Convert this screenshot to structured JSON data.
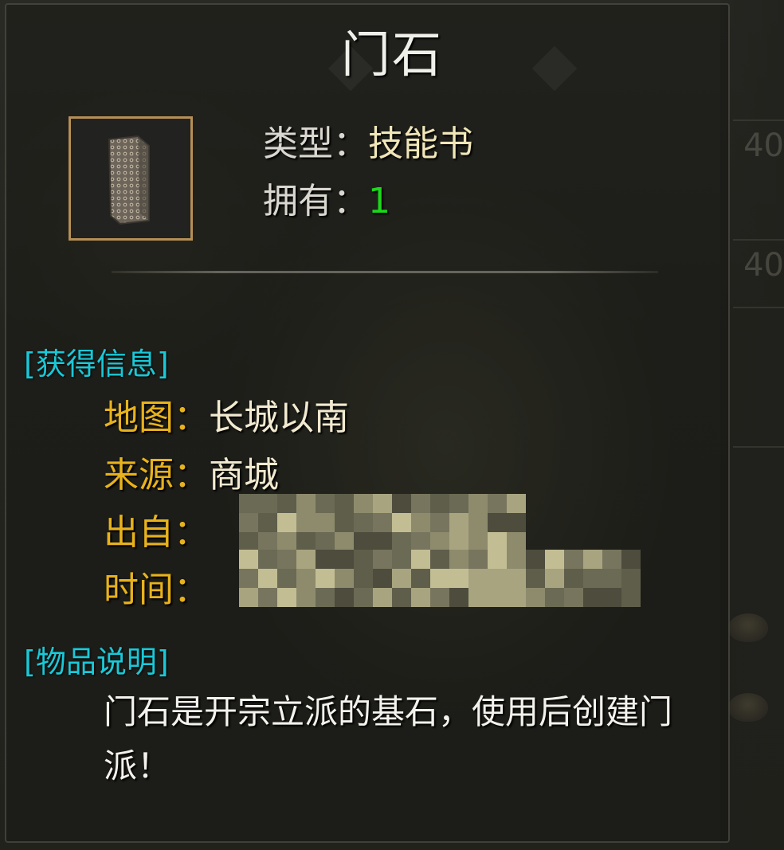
{
  "item": {
    "name": "门石",
    "icon": "stone-tablet-icon",
    "type_label": "类型：",
    "type_value": "技能书",
    "owned_label": "拥有：",
    "owned_value": "1"
  },
  "acquisition": {
    "section_title": "[获得信息]",
    "map_label": "地图：",
    "map_value": "长城以南",
    "source_label": "来源：",
    "source_value": "商城",
    "origin_label": "出自：",
    "time_label": "时间："
  },
  "description": {
    "section_title": "[物品说明]",
    "text": "门石是开宗立派的基石，使用后创建门派！"
  },
  "colors": {
    "section": "#19c9d8",
    "field_label": "#e8b21c",
    "owned_count": "#1cd81c",
    "icon_border": "#b58f55"
  }
}
